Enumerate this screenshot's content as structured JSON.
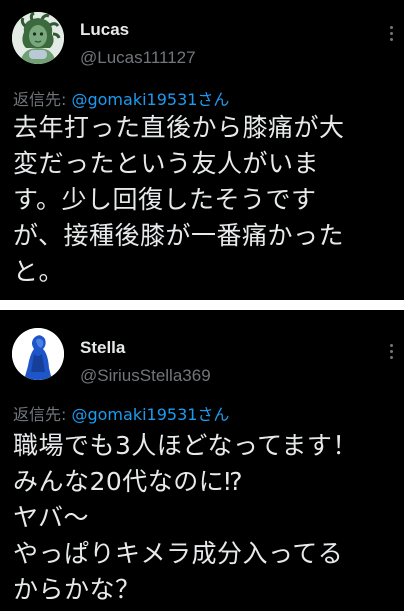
{
  "tweets": [
    {
      "display_name": "Lucas",
      "handle": "@Lucas111127",
      "reply_prefix": "返信先: ",
      "reply_to": "@gomaki19531さん",
      "text": "去年打った直後から膝痛が大\n変だったという友人がいま\nす。少し回復したそうです\nが、接種後膝が一番痛かった\nと。",
      "avatar_icon": "medusa-avatar-icon",
      "more_icon": "more-options-icon"
    },
    {
      "display_name": "Stella",
      "handle": "@SiriusStella369",
      "reply_prefix": "返信先: ",
      "reply_to": "@gomaki19531さん",
      "text": "職場でも3人ほどなってます！\nみんな20代なのに⁉\nヤバ〜\nやっぱりキメラ成分入ってる\nからかな？",
      "avatar_icon": "blue-silhouette-avatar-icon",
      "more_icon": "more-options-icon"
    }
  ],
  "colors": {
    "background": "#000000",
    "text": "#e7e9ea",
    "secondary": "#71767b",
    "link": "#1d9bf0",
    "divider": "#ffffff"
  }
}
